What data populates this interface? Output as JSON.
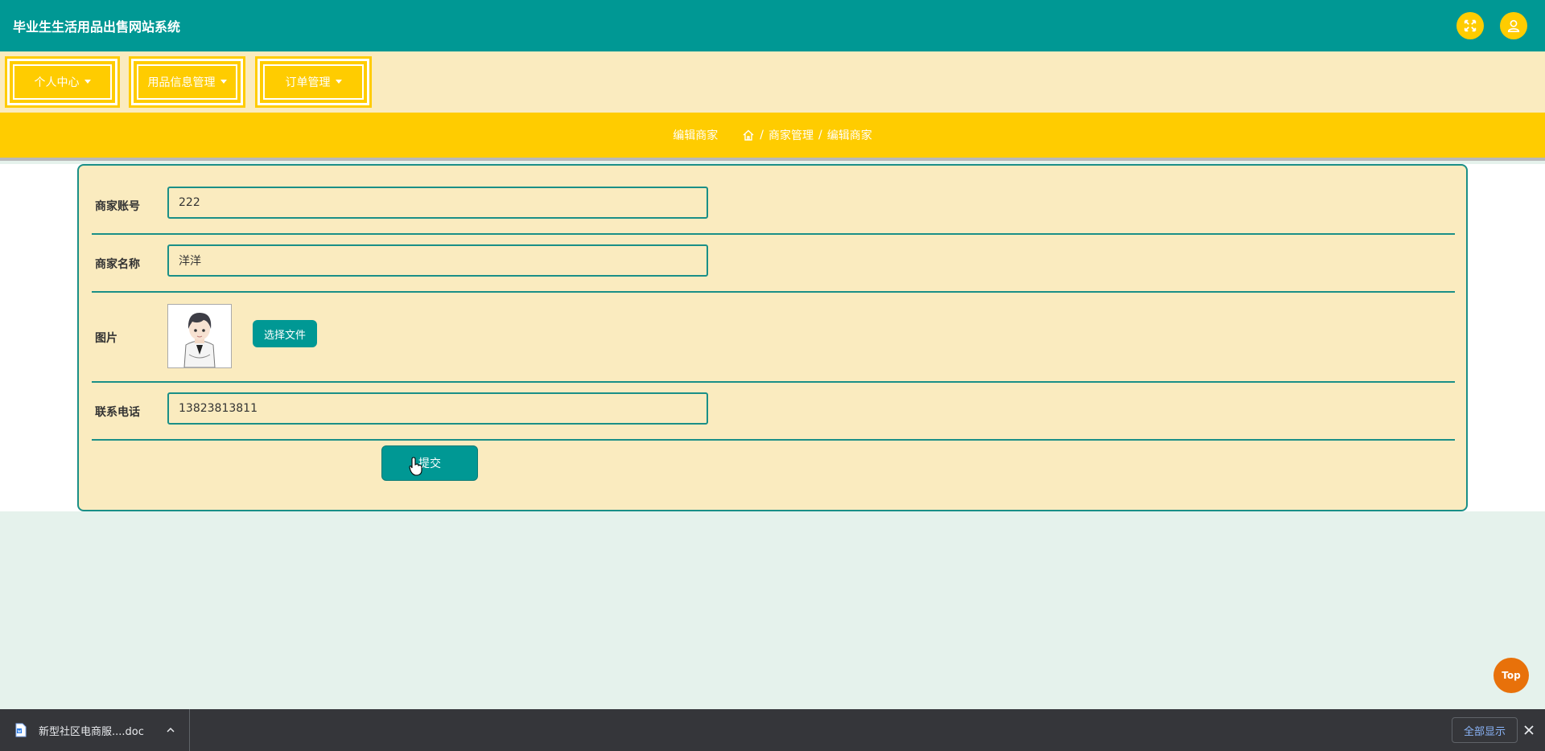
{
  "header": {
    "title": "毕业生生活用品出售网站系统",
    "fullscreen_icon": "expand-icon",
    "user_icon": "user-icon"
  },
  "menu": {
    "items": [
      {
        "label": "个人中心"
      },
      {
        "label": "用品信息管理"
      },
      {
        "label": "订单管理"
      }
    ]
  },
  "breadcrumb": {
    "page_title": "编辑商家",
    "home_icon": "home-icon",
    "separator": "/",
    "level1": "商家管理",
    "level2": "编辑商家"
  },
  "form": {
    "fields": [
      {
        "label": "商家账号",
        "value": "222"
      },
      {
        "label": "商家名称",
        "value": "洋洋"
      },
      {
        "label": "图片",
        "button": "选择文件"
      },
      {
        "label": "联系电话",
        "value": "13823813811"
      }
    ],
    "submit_label": "提交"
  },
  "back_to_top": "Top",
  "download_bar": {
    "file_name": "新型社区电商服....doc",
    "show_all": "全部显示"
  },
  "colors": {
    "primary": "#009894",
    "accent": "#ffcc00",
    "panel": "#faebbf",
    "top_button": "#e8710a"
  }
}
